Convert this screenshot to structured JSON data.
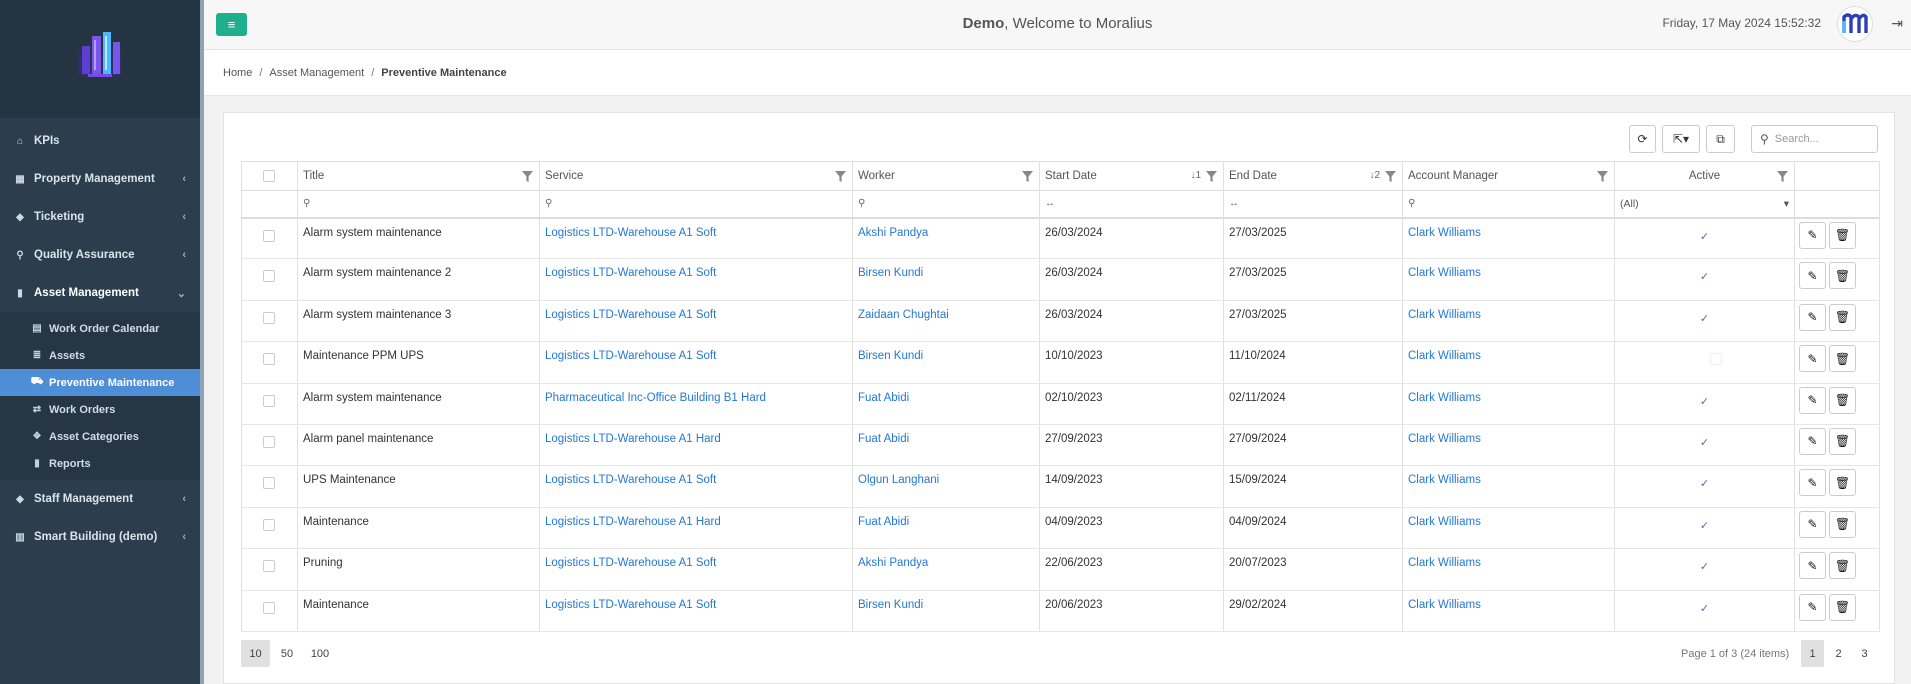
{
  "header": {
    "brand": "Demo",
    "welcome": ", Welcome to Moralius",
    "datetime": "Friday, 17 May 2024 15:52:32"
  },
  "sidebar": {
    "items": [
      {
        "label": "KPIs",
        "icon": "home-icon"
      },
      {
        "label": "Property Management",
        "icon": "building-icon"
      },
      {
        "label": "Ticketing",
        "icon": "tag-icon"
      },
      {
        "label": "Quality Assurance",
        "icon": "search-icon"
      },
      {
        "label": "Asset Management",
        "icon": "book-icon"
      }
    ],
    "subitems": [
      {
        "label": "Work Order Calendar",
        "icon": "calendar-icon"
      },
      {
        "label": "Assets",
        "icon": "list-icon"
      },
      {
        "label": "Preventive Maintenance",
        "icon": "truck-icon"
      },
      {
        "label": "Work Orders",
        "icon": "retweet-icon"
      },
      {
        "label": "Asset Categories",
        "icon": "cubes-icon"
      },
      {
        "label": "Reports",
        "icon": "book-icon"
      }
    ],
    "bottom": [
      {
        "label": "Staff Management",
        "icon": "tag-icon"
      },
      {
        "label": "Smart Building (demo)",
        "icon": "bar-chart-icon"
      }
    ]
  },
  "breadcrumb": {
    "home": "Home",
    "section": "Asset Management",
    "current": "Preventive Maintenance"
  },
  "toolbar": {
    "search_placeholder": "Search..."
  },
  "grid": {
    "columns": {
      "title": "Title",
      "service": "Service",
      "worker": "Worker",
      "start": "Start Date",
      "end": "End Date",
      "manager": "Account Manager",
      "active": "Active"
    },
    "sort_start": "↓1",
    "sort_end": "↓2",
    "active_filter": "(All)",
    "rows": [
      {
        "title": "Alarm system maintenance",
        "service": "Logistics LTD-Warehouse A1 Soft",
        "worker": "Akshi Pandya",
        "start": "26/03/2024",
        "end": "27/03/2025",
        "manager": "Clark Williams",
        "active": true
      },
      {
        "title": "Alarm system maintenance 2",
        "service": "Logistics LTD-Warehouse A1 Soft",
        "worker": "Birsen Kundi",
        "start": "26/03/2024",
        "end": "27/03/2025",
        "manager": "Clark Williams",
        "active": true
      },
      {
        "title": "Alarm system maintenance 3",
        "service": "Logistics LTD-Warehouse A1 Soft",
        "worker": "Zaidaan Chughtai",
        "start": "26/03/2024",
        "end": "27/03/2025",
        "manager": "Clark Williams",
        "active": true
      },
      {
        "title": "Maintenance PPM UPS",
        "service": "Logistics LTD-Warehouse A1 Soft",
        "worker": "Birsen Kundi",
        "start": "10/10/2023",
        "end": "11/10/2024",
        "manager": "Clark Williams",
        "active": false
      },
      {
        "title": "Alarm system maintenance",
        "service": "Pharmaceutical Inc-Office Building B1 Hard",
        "worker": "Fuat Abidi",
        "start": "02/10/2023",
        "end": "02/11/2024",
        "manager": "Clark Williams",
        "active": true
      },
      {
        "title": "Alarm panel maintenance",
        "service": "Logistics LTD-Warehouse A1 Hard",
        "worker": "Fuat Abidi",
        "start": "27/09/2023",
        "end": "27/09/2024",
        "manager": "Clark Williams",
        "active": true
      },
      {
        "title": "UPS Maintenance",
        "service": "Logistics LTD-Warehouse A1 Soft",
        "worker": "Olgun Langhani",
        "start": "14/09/2023",
        "end": "15/09/2024",
        "manager": "Clark Williams",
        "active": true
      },
      {
        "title": "Maintenance",
        "service": "Logistics LTD-Warehouse A1 Hard",
        "worker": "Fuat Abidi",
        "start": "04/09/2023",
        "end": "04/09/2024",
        "manager": "Clark Williams",
        "active": true
      },
      {
        "title": "Pruning",
        "service": "Logistics LTD-Warehouse A1 Soft",
        "worker": "Akshi Pandya",
        "start": "22/06/2023",
        "end": "20/07/2023",
        "manager": "Clark Williams",
        "active": true
      },
      {
        "title": "Maintenance",
        "service": "Logistics LTD-Warehouse A1 Soft",
        "worker": "Birsen Kundi",
        "start": "20/06/2023",
        "end": "29/02/2024",
        "manager": "Clark Williams",
        "active": true
      }
    ]
  },
  "pager": {
    "sizes": [
      "10",
      "50",
      "100"
    ],
    "info": "Page 1 of 3 (24 items)",
    "pages": [
      "1",
      "2",
      "3"
    ]
  }
}
